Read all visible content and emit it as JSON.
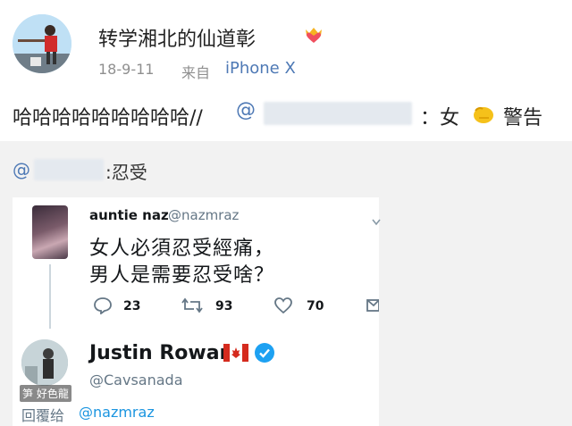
{
  "post": {
    "username": "转学湘北的仙道彰",
    "time": "18-9-11",
    "from_label": "来自",
    "device": "iPhone X",
    "repost_text": "哈哈哈哈哈哈哈哈哈//",
    "repost_at": "@",
    "repost_tail": "：女",
    "repost_warn": "警告"
  },
  "quote": {
    "at": "@",
    "text": ":忍受"
  },
  "tweet1": {
    "name": "auntie naz",
    "handle": "@nazmraz",
    "line1": "女人必須忍受經痛，",
    "line2": "男人是需要忍受啥？",
    "replies": "23",
    "retweets": "93",
    "likes": "70"
  },
  "tweet2": {
    "name": "Justin Rowan",
    "handle": "@Cavsanada",
    "watermark": "笋 好色龍",
    "replying_prefix": "回覆给",
    "replying_handle": "@nazmraz"
  },
  "icons": {
    "vip": "crown-heart-icon",
    "fist": "fist-icon",
    "reply": "reply-icon",
    "retweet": "retweet-icon",
    "like": "heart-icon",
    "dm": "message-icon",
    "flag": "canada-flag-icon",
    "verified": "verified-check-icon",
    "menu": "chevron-down-icon"
  },
  "colors": {
    "link_blue": "#4e79b5",
    "twitter_blue": "#1b95e0",
    "quote_bg": "#f2f2f2",
    "flag_red": "#d52b1e"
  }
}
